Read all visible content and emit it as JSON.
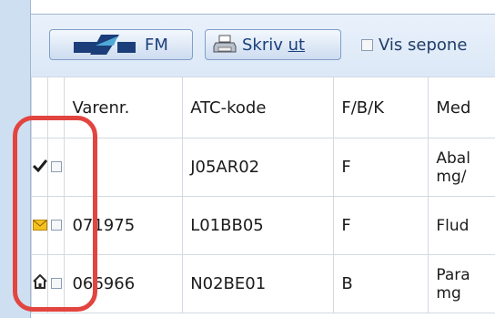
{
  "toolbar": {
    "fm_label": "FM",
    "print_label_prefix": "Skriv ",
    "print_label_underlined": "ut",
    "show_discontinued_label": "Vis sepone"
  },
  "table": {
    "headers": {
      "icon": "",
      "checkbox": "",
      "varenr": "Varenr.",
      "atc": "ATC-kode",
      "fbk": "F/B/K",
      "med": "Med"
    },
    "rows": [
      {
        "icon": "checkmark-icon",
        "varenr": "",
        "atc": "J05AR02",
        "fbk": "F",
        "med_line1": "Abal",
        "med_line2": "mg/"
      },
      {
        "icon": "envelope-icon",
        "varenr": "071975",
        "atc": "L01BB05",
        "fbk": "F",
        "med_line1": "Flud",
        "med_line2": ""
      },
      {
        "icon": "house-icon",
        "varenr": "066966",
        "atc": "N02BE01",
        "fbk": "B",
        "med_line1": "Para",
        "med_line2": "mg"
      }
    ]
  },
  "colors": {
    "annotation": "#e2443f",
    "envelope": "#f4c21d"
  }
}
